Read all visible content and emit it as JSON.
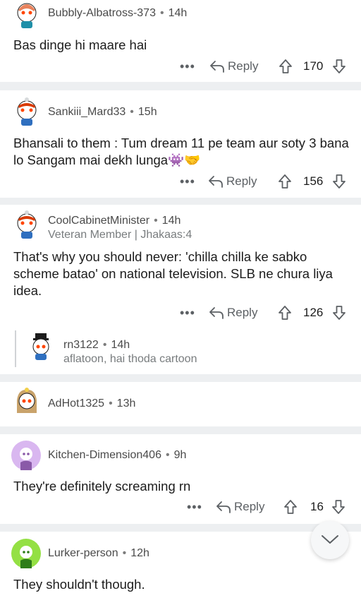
{
  "comments": [
    {
      "user": "Bubbly-Albatross-373",
      "time": "14h",
      "body": "Bas dinge hi maare hai",
      "reply_label": "Reply",
      "score": "170",
      "avatar_icon": "snoo-avatar-icon"
    },
    {
      "user": "Sankiii_Mard33",
      "time": "15h",
      "body": "Bhansali to them : Tum dream 11 pe team aur soty 3 bana lo Sangam mai dekh lunga👾🤝",
      "reply_label": "Reply",
      "score": "156",
      "avatar_icon": "snoo-avatar-icon"
    },
    {
      "user": "CoolCabinetMinister",
      "time": "14h",
      "flair": "Veteran Member | Jhakaas:4",
      "body": "That's why you should never: 'chilla chilla ke sabko scheme batao' on national television. SLB ne chura liya idea.",
      "reply_label": "Reply",
      "score": "126",
      "avatar_icon": "snoo-avatar-icon"
    },
    {
      "user": "rn3122",
      "time": "14h",
      "preview": "aflatoon, hai thoda cartoon",
      "avatar_icon": "snoo-avatar-icon"
    },
    {
      "user": "AdHot1325",
      "time": "13h",
      "avatar_icon": "snoo-avatar-icon"
    },
    {
      "user": "Kitchen-Dimension406",
      "time": "9h",
      "body": "They're definitely screaming rn",
      "reply_label": "Reply",
      "score": "16",
      "avatar_icon": "snoo-avatar-icon"
    },
    {
      "user": "Lurker-person",
      "time": "12h",
      "body": "They shouldn't though.",
      "avatar_icon": "snoo-avatar-icon"
    }
  ],
  "icons": {
    "more": "more-options-icon",
    "reply": "reply-arrow-icon",
    "upvote": "upvote-arrow-icon",
    "downvote": "downvote-arrow-icon",
    "collapse": "chevron-down-icon"
  },
  "colors": {
    "background": "#edeff1",
    "card": "#ffffff",
    "text": "#1c1c1c",
    "muted": "#787c7e"
  }
}
